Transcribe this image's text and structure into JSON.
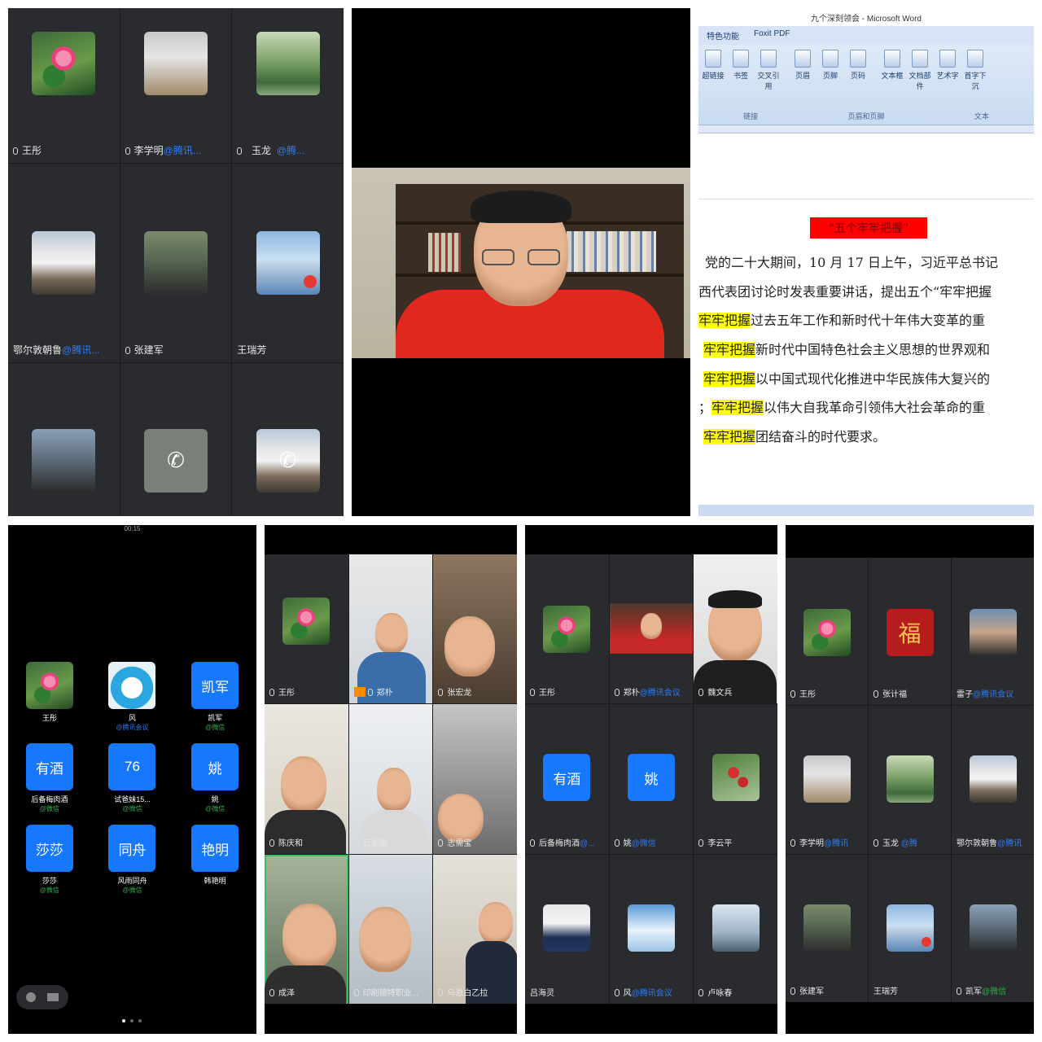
{
  "panel1": {
    "tiles": [
      {
        "name": "王彤",
        "tag": "",
        "art": "flower"
      },
      {
        "name": "李学明",
        "tag": "@腾讯...",
        "art": "yoga"
      },
      {
        "name": "玉龙",
        "tag": "@腾...",
        "art": "forest"
      },
      {
        "name": "鄂尔敦朝鲁",
        "tag": "@腾讯...",
        "art": "temple"
      },
      {
        "name": "张建军",
        "tag": "",
        "art": "person"
      },
      {
        "name": "王瑞芳",
        "tag": "",
        "art": "girlphoto"
      },
      {
        "name": "",
        "tag": "",
        "art": "person"
      },
      {
        "name": "",
        "tag": "",
        "art": "phone"
      },
      {
        "name": "",
        "tag": "",
        "art": "temple"
      }
    ]
  },
  "word": {
    "title": "九个深刻领会 - Microsoft Word",
    "tabs": [
      "特色功能",
      "Foxit PDF"
    ],
    "buttons": [
      "超链接",
      "书签",
      "交叉引用",
      "页眉",
      "页脚",
      "页码",
      "文本框",
      "文档部件",
      "艺术字",
      "首字下沉"
    ],
    "groups": [
      "链接",
      "页眉和页脚",
      "文本"
    ],
    "heading": "“五个牢牢把握”",
    "lines": [
      {
        "pre": "党的二十大期间，10 月 17 日上午，习近平总书记",
        "hl": "",
        "post": ""
      },
      {
        "pre": "西代表团讨论时发表重要讲话，提出五个“牢牢把握",
        "hl": "",
        "post": ""
      },
      {
        "pre": "",
        "hl": "牢牢把握",
        "post": "过去五年工作和新时代十年伟大变革的重"
      },
      {
        "pre": "",
        "hl": "牢牢把握",
        "post": "新时代中国特色社会主义思想的世界观和"
      },
      {
        "pre": "",
        "hl": "牢牢把握",
        "post": "以中国式现代化推进中华民族伟大复兴的"
      },
      {
        "pre": "；",
        "hl": "牢牢把握",
        "post": "以伟大自我革命引领伟大社会革命的重"
      },
      {
        "pre": "",
        "hl": "牢牢把握",
        "post": "团结奋斗的时代要求。"
      }
    ]
  },
  "phone": {
    "time": "00:15",
    "items": [
      {
        "name": "王彤",
        "sub": "",
        "label": "",
        "art": "flower"
      },
      {
        "name": "风",
        "sub": "@腾讯会议",
        "label": "",
        "art": "cartoon"
      },
      {
        "name": "凯军",
        "sub": "@微信",
        "label": "凯军",
        "art": "blue"
      },
      {
        "name": "后备梅肉酒",
        "sub": "@微信",
        "label": "有酒",
        "art": "blue"
      },
      {
        "name": "试爸妹15...",
        "sub": "@微信",
        "label": "76",
        "art": "blue"
      },
      {
        "name": "姚",
        "sub": "@微信",
        "label": "姚",
        "art": "blue"
      },
      {
        "name": "莎莎",
        "sub": "@微信",
        "label": "莎莎",
        "art": "blue"
      },
      {
        "name": "风雨同舟",
        "sub": "@微信",
        "label": "同舟",
        "art": "blue"
      },
      {
        "name": "韩艳明",
        "sub": "",
        "label": "艳明",
        "art": "blue"
      }
    ]
  },
  "panel5": {
    "tiles": [
      "王彤",
      "郑朴",
      "张宏龙",
      "陈庆和",
      "云志刚",
      "志需宝",
      "成泽",
      "印刷德特职业...",
      "乌恩白乙拉"
    ]
  },
  "panel6": {
    "tiles": [
      {
        "name": "王彤",
        "tag": "",
        "label": ""
      },
      {
        "name": "郑朴",
        "tag": "@腾讯会议",
        "label": ""
      },
      {
        "name": "魏文兵",
        "tag": "",
        "label": ""
      },
      {
        "name": "后备梅肉酒",
        "tag": "@...",
        "label": "有酒"
      },
      {
        "name": "姚",
        "tag": "@微信",
        "label": "姚"
      },
      {
        "name": "李云平",
        "tag": "",
        "label": ""
      },
      {
        "name": "吕海灵",
        "tag": "",
        "label": ""
      },
      {
        "name": "风",
        "tag": "@腾讯会议",
        "label": ""
      },
      {
        "name": "卢咏春",
        "tag": "",
        "label": ""
      }
    ]
  },
  "panel7": {
    "tiles": [
      {
        "name": "王彤",
        "tag": ""
      },
      {
        "name": "张计福",
        "tag": ""
      },
      {
        "name": "雷子",
        "tag": "@腾讯会议"
      },
      {
        "name": "李学明",
        "tag": "@腾讯"
      },
      {
        "name": "玉龙",
        "tag": "@腾"
      },
      {
        "name": "鄂尔敦朝鲁",
        "tag": "@腾讯"
      },
      {
        "name": "张建军",
        "tag": ""
      },
      {
        "name": "王瑞芳",
        "tag": ""
      },
      {
        "name": "凯军",
        "tag": "@微信"
      }
    ]
  }
}
